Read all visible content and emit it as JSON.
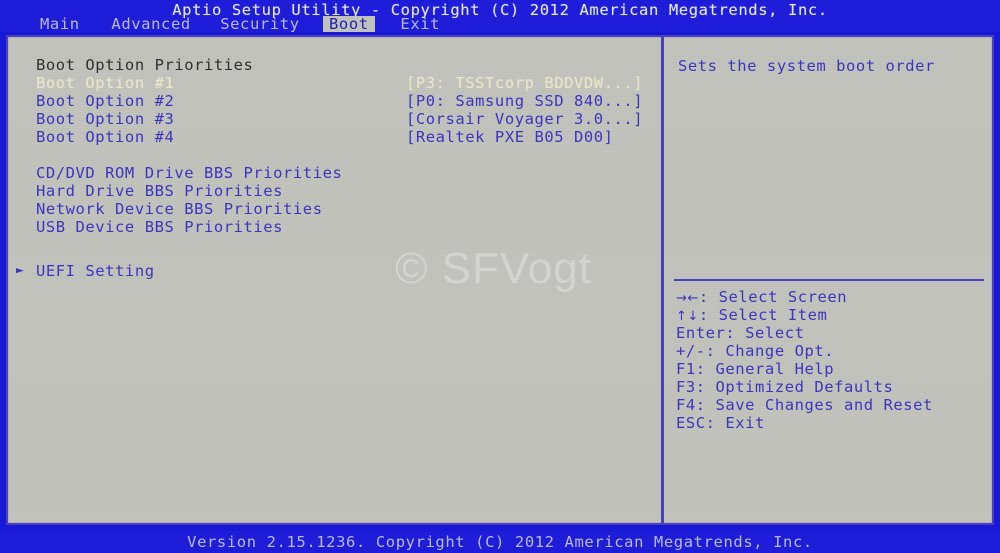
{
  "window": {
    "title": "Aptio Setup Utility - Copyright (C) 2012 American Megatrends, Inc.",
    "footer": "Version 2.15.1236. Copyright (C) 2012 American Megatrends, Inc.",
    "watermark": "© SFVogt"
  },
  "colors": {
    "header_blue": "#1d1ddb",
    "panel_gray": "#c3c3be",
    "border_blue": "#4a3fc4",
    "text_blue": "#3b35c0",
    "text_dark": "#30302e",
    "selected_cream": "#e9e6c9",
    "inactive_tab": "#b9b9e4"
  },
  "menu": {
    "tabs": [
      {
        "label": "Main",
        "active": false
      },
      {
        "label": "Advanced",
        "active": false
      },
      {
        "label": "Security",
        "active": false
      },
      {
        "label": "Boot",
        "active": true
      },
      {
        "label": "Exit",
        "active": false
      }
    ]
  },
  "settings": {
    "section_heading": "Boot Option Priorities",
    "boot_options": [
      {
        "label": "Boot Option #1",
        "value": "[P3: TSSTcorp BDDVDW...]",
        "selected": true
      },
      {
        "label": "Boot Option #2",
        "value": "[P0: Samsung SSD 840...]",
        "selected": false
      },
      {
        "label": "Boot Option #3",
        "value": "[Corsair Voyager 3.0...]",
        "selected": false
      },
      {
        "label": "Boot Option #4",
        "value": "[Realtek PXE B05 D00]",
        "selected": false
      }
    ],
    "bbs_priorities": [
      {
        "label": "CD/DVD ROM Drive BBS Priorities"
      },
      {
        "label": "Hard Drive BBS Priorities"
      },
      {
        "label": "Network Device BBS Priorities"
      },
      {
        "label": "USB Device BBS Priorities"
      }
    ],
    "submenu": {
      "marker": "►",
      "label": "UEFI Setting"
    }
  },
  "help": {
    "description": "Sets the system boot order",
    "keys": [
      {
        "glyph": "→←",
        "text": ": Select Screen"
      },
      {
        "glyph": "↑↓",
        "text": ": Select Item"
      },
      {
        "glyph": "",
        "text": "Enter: Select"
      },
      {
        "glyph": "",
        "text": "+/-: Change Opt."
      },
      {
        "glyph": "",
        "text": "F1: General Help"
      },
      {
        "glyph": "",
        "text": "F3: Optimized Defaults"
      },
      {
        "glyph": "",
        "text": "F4: Save Changes and Reset"
      },
      {
        "glyph": "",
        "text": "ESC: Exit"
      }
    ]
  }
}
